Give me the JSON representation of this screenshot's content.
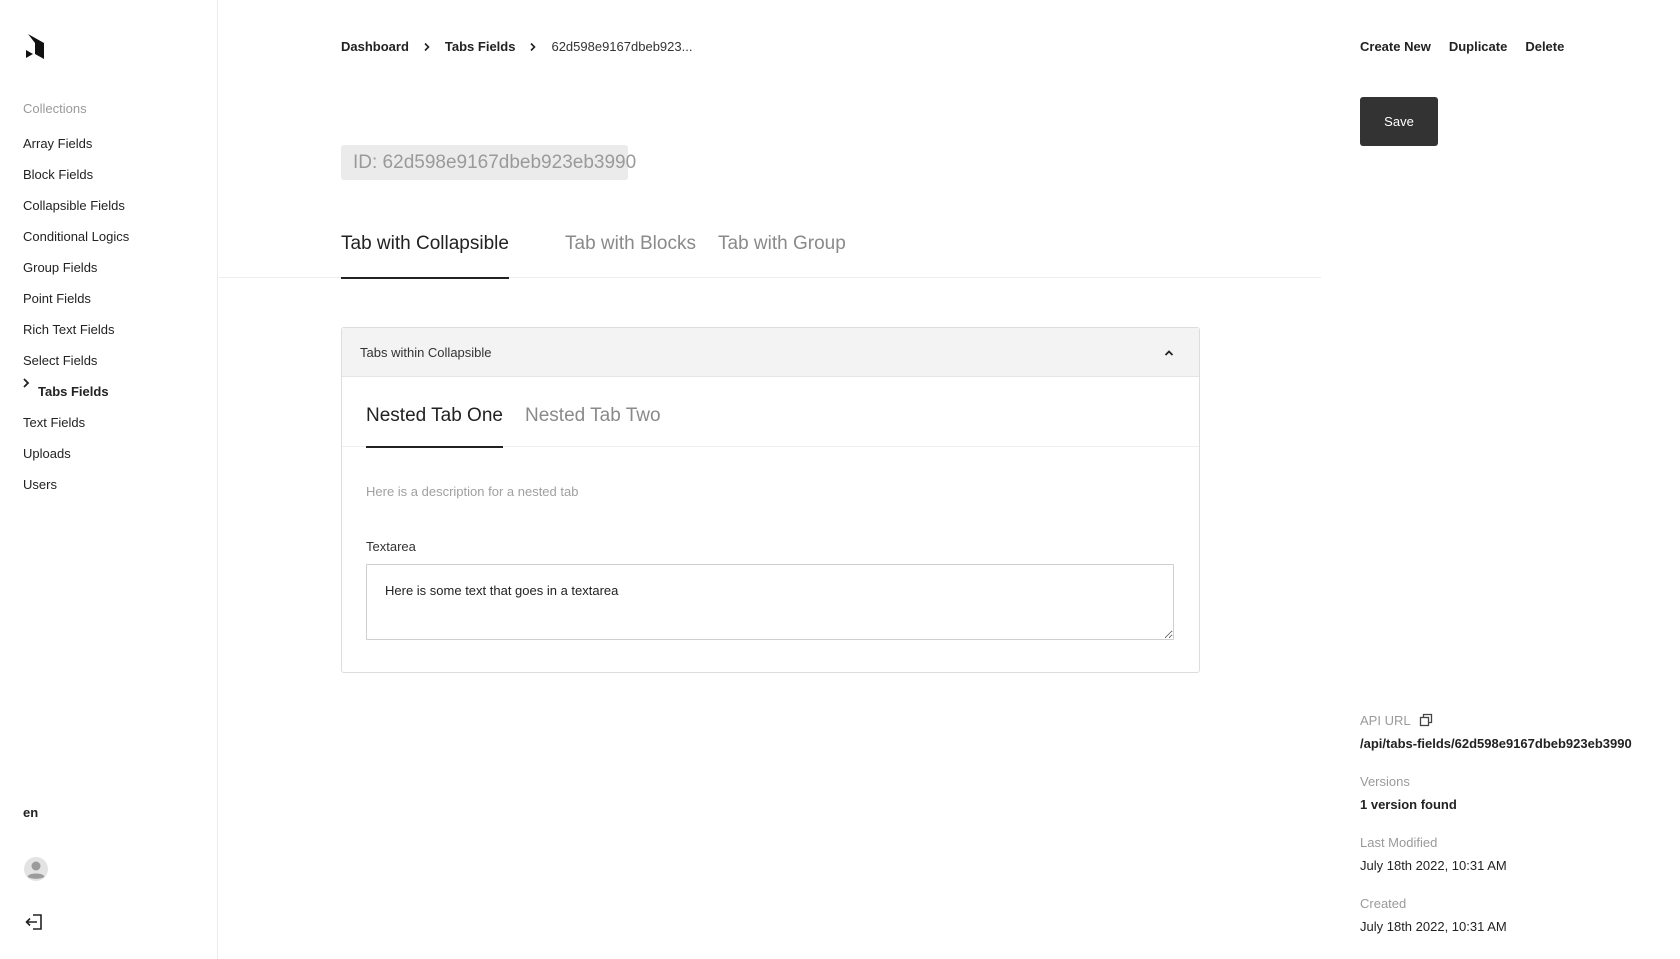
{
  "sidebar": {
    "logo_icon": "payload-logo-icon",
    "collections_label": "Collections",
    "items": [
      {
        "label": "Array Fields"
      },
      {
        "label": "Block Fields"
      },
      {
        "label": "Collapsible Fields"
      },
      {
        "label": "Conditional Logics"
      },
      {
        "label": "Group Fields"
      },
      {
        "label": "Point Fields"
      },
      {
        "label": "Rich Text Fields"
      },
      {
        "label": "Select Fields"
      },
      {
        "label": "Tabs Fields",
        "active": true
      },
      {
        "label": "Text Fields"
      },
      {
        "label": "Uploads"
      },
      {
        "label": "Users"
      }
    ],
    "language": "en",
    "avatar_icon": "user-avatar-icon",
    "logout_icon": "logout-icon"
  },
  "breadcrumb": {
    "items": [
      "Dashboard",
      "Tabs Fields",
      "62d598e9167dbeb923..."
    ]
  },
  "document": {
    "id_label": "ID: 62d598e9167dbeb923eb3990"
  },
  "tabs": [
    {
      "label": "Tab with Collapsible",
      "active": true
    },
    {
      "label": "Tab with Blocks"
    },
    {
      "label": "Tab with Group"
    }
  ],
  "collapsible": {
    "title": "Tabs within Collapsible",
    "toggle_icon": "chevron-up-icon",
    "nested_tabs": [
      {
        "label": "Nested Tab One",
        "active": true
      },
      {
        "label": "Nested Tab Two"
      }
    ],
    "description": "Here is a description for a nested tab",
    "textarea_label": "Textarea",
    "textarea_value": "Here is some text that goes in a textarea"
  },
  "panel": {
    "create_new": "Create New",
    "duplicate": "Duplicate",
    "delete": "Delete",
    "save": "Save",
    "api_url_label": "API URL",
    "api_url": "/api/tabs-fields/62d598e9167dbeb923eb3990",
    "versions_label": "Versions",
    "versions_value": "1 version found",
    "last_modified_label": "Last Modified",
    "last_modified_value": "July 18th 2022, 10:31 AM",
    "created_label": "Created",
    "created_value": "July 18th 2022, 10:31 AM"
  },
  "colors": {
    "accent": "#333333",
    "muted": "#9a9a9a",
    "border": "#dddddd"
  }
}
